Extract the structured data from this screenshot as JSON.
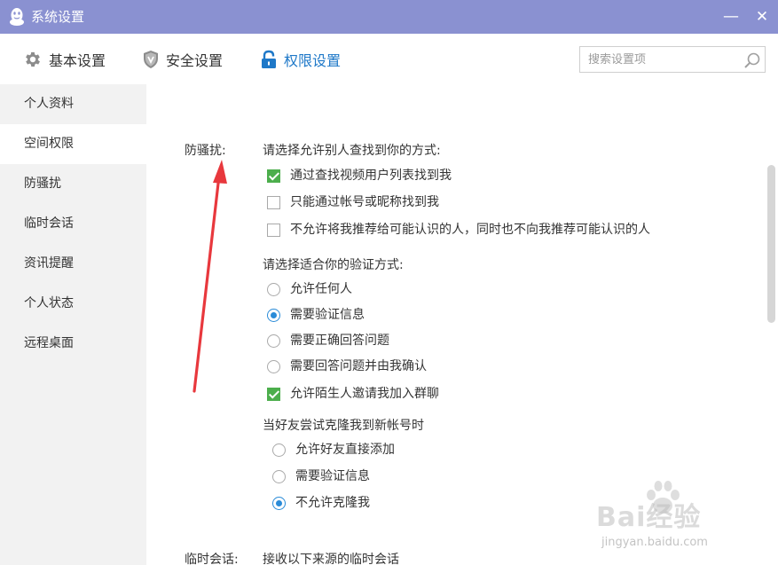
{
  "window": {
    "title": "系统设置",
    "minimize_glyph": "—",
    "close_glyph": "✕"
  },
  "toolbar": {
    "tabs": [
      {
        "label": "基本设置",
        "icon": "gear-icon"
      },
      {
        "label": "安全设置",
        "icon": "shield-icon"
      },
      {
        "label": "权限设置",
        "icon": "lock-icon",
        "active": true
      }
    ],
    "search_placeholder": "搜索设置项"
  },
  "sidebar": {
    "items": [
      {
        "label": "个人资料"
      },
      {
        "label": "空间权限",
        "active": true
      },
      {
        "label": "防骚扰"
      },
      {
        "label": "临时会话"
      },
      {
        "label": "资讯提醒"
      },
      {
        "label": "个人状态"
      },
      {
        "label": "远程桌面"
      }
    ]
  },
  "main": {
    "anti_harass": {
      "label": "防骚扰:",
      "find_title": "请选择允许别人查找到你的方式:",
      "find_options": [
        {
          "label": "通过查找视频用户列表找到我",
          "checked": true
        },
        {
          "label": "只能通过帐号或昵称找到我",
          "checked": false
        },
        {
          "label": "不允许将我推荐给可能认识的人，同时也不向我推荐可能认识的人",
          "checked": false
        }
      ],
      "verify_title": "请选择适合你的验证方式:",
      "verify_options": [
        {
          "label": "允许任何人",
          "selected": false
        },
        {
          "label": "需要验证信息",
          "selected": true
        },
        {
          "label": "需要正确回答问题",
          "selected": false
        },
        {
          "label": "需要回答问题并由我确认",
          "selected": false
        }
      ],
      "group_invite": {
        "label": "允许陌生人邀请我加入群聊",
        "checked": true
      },
      "clone_title": "当好友尝试克隆我到新帐号时",
      "clone_options": [
        {
          "label": "允许好友直接添加",
          "selected": false
        },
        {
          "label": "需要验证信息",
          "selected": false
        },
        {
          "label": "不允许克隆我",
          "selected": true
        }
      ]
    },
    "temp_session": {
      "label": "临时会话:",
      "title": "接收以下来源的临时会话"
    }
  },
  "watermark": {
    "text": "Bai经验",
    "sub": "jingyan.baidu.com"
  },
  "colors": {
    "titlebar": "#8a91d1",
    "accent": "#1e78c8",
    "check_green": "#4cae4c",
    "radio_blue": "#2a8bd8",
    "arrow_red": "#e8383d",
    "sidebar_bg": "#f2f2f2"
  }
}
